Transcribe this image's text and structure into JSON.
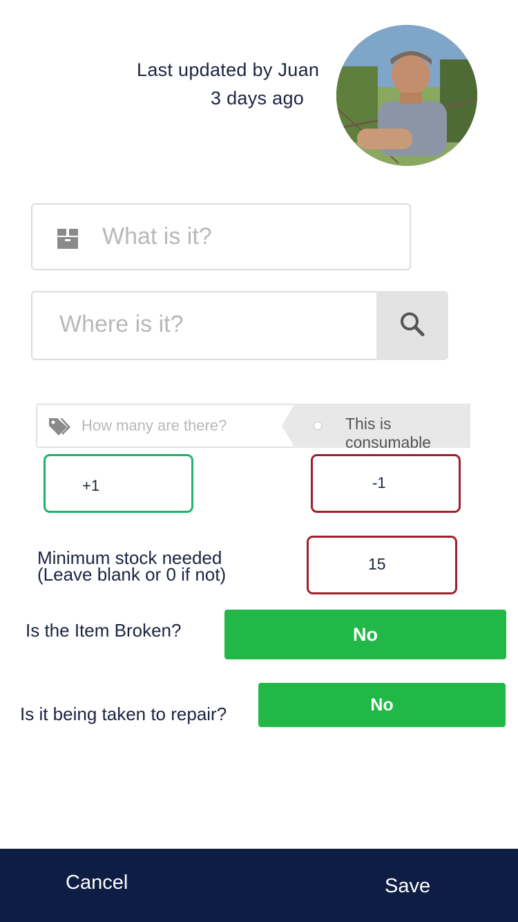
{
  "header": {
    "updated_line1": "Last updated by Juan",
    "updated_line2": "3 days ago"
  },
  "fields": {
    "what_placeholder": "What is it?",
    "where_placeholder": "Where is it?",
    "how_many_placeholder": "How many are there?",
    "consumable_label": "This is consumable"
  },
  "stepper": {
    "plus_label": "+1",
    "minus_label": "-1"
  },
  "min_stock": {
    "label_line1": "Minimum stock needed",
    "label_line2": "(Leave blank or 0 if not)",
    "value": "15"
  },
  "broken": {
    "question": "Is the Item Broken?",
    "answer": "No"
  },
  "repair": {
    "question": "Is it being taken to repair?",
    "answer": "No"
  },
  "footer": {
    "cancel_label": "Cancel",
    "save_label": "Save"
  },
  "colors": {
    "navy": "#0d1d44",
    "green_button": "#22b848",
    "plus_border": "#1fb26b",
    "minus_border": "#a11f2b"
  },
  "icons": {
    "what_field": "box-icon",
    "where_field": "search-icon",
    "how_many_field": "tags-icon",
    "consumable": "toggle-dot-icon"
  }
}
